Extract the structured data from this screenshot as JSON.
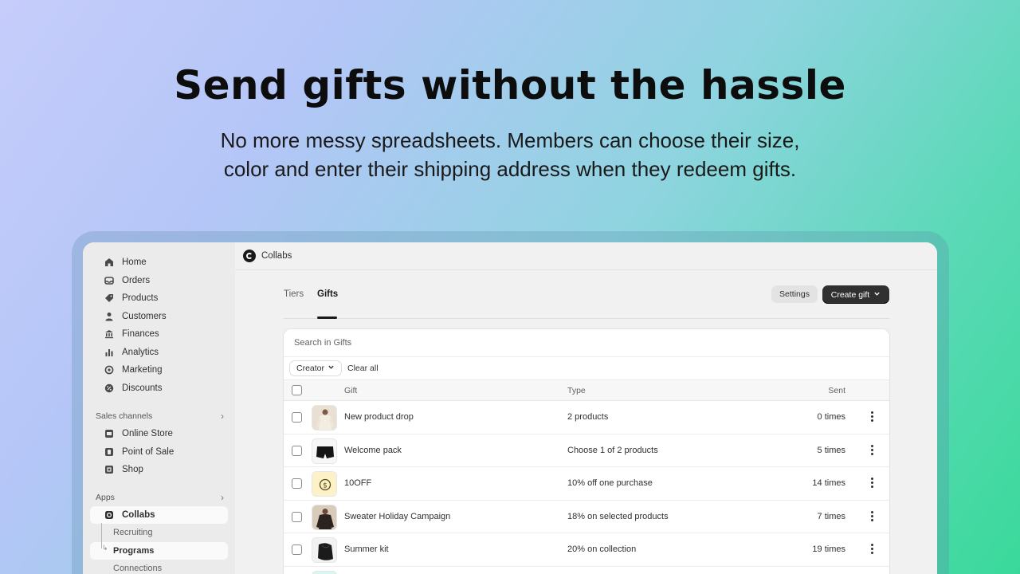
{
  "hero": {
    "title": "Send gifts without the hassle",
    "subtitle_line1": "No more messy spreadsheets. Members can choose their size,",
    "subtitle_line2": "color and enter their shipping address when they redeem gifts."
  },
  "sidebar": {
    "items": [
      {
        "label": "Home",
        "icon": "home-icon"
      },
      {
        "label": "Orders",
        "icon": "inbox-icon"
      },
      {
        "label": "Products",
        "icon": "tag-icon"
      },
      {
        "label": "Customers",
        "icon": "person-icon"
      },
      {
        "label": "Finances",
        "icon": "bank-icon"
      },
      {
        "label": "Analytics",
        "icon": "bar-chart-icon"
      },
      {
        "label": "Marketing",
        "icon": "target-icon"
      },
      {
        "label": "Discounts",
        "icon": "discount-icon"
      }
    ],
    "sales_channels": {
      "title": "Sales channels",
      "items": [
        {
          "label": "Online Store",
          "icon": "store-icon"
        },
        {
          "label": "Point of Sale",
          "icon": "pos-icon"
        },
        {
          "label": "Shop",
          "icon": "shop-icon"
        }
      ]
    },
    "apps": {
      "title": "Apps",
      "current": {
        "label": "Collabs",
        "icon": "collabs-icon"
      },
      "sub_items": [
        "Recruiting",
        "Programs",
        "Connections"
      ]
    }
  },
  "topbar": {
    "app_name": "Collabs"
  },
  "tabs": [
    "Tiers",
    "Gifts"
  ],
  "toolbar": {
    "settings_label": "Settings",
    "create_label": "Create gift"
  },
  "table": {
    "search_placeholder": "Search in Gifts",
    "filter_label": "Creator",
    "clear_label": "Clear all",
    "headers": {
      "gift": "Gift",
      "type": "Type",
      "sent": "Sent"
    },
    "rows": [
      {
        "name": "New product drop",
        "type": "2 products",
        "sent": "0 times",
        "thumb": "sweater-cream"
      },
      {
        "name": "Welcome pack",
        "type": "Choose 1 of 2 products",
        "sent": "5 times",
        "thumb": "shorts-black"
      },
      {
        "name": "10OFF",
        "type": "10% off one purchase",
        "sent": "14 times",
        "thumb": "coin-discount"
      },
      {
        "name": "Sweater Holiday Campaign",
        "type": "18% on selected products",
        "sent": "7 times",
        "thumb": "sweater-dark"
      },
      {
        "name": "Summer kit",
        "type": "20% on collection",
        "sent": "19 times",
        "thumb": "bag-black"
      }
    ]
  }
}
